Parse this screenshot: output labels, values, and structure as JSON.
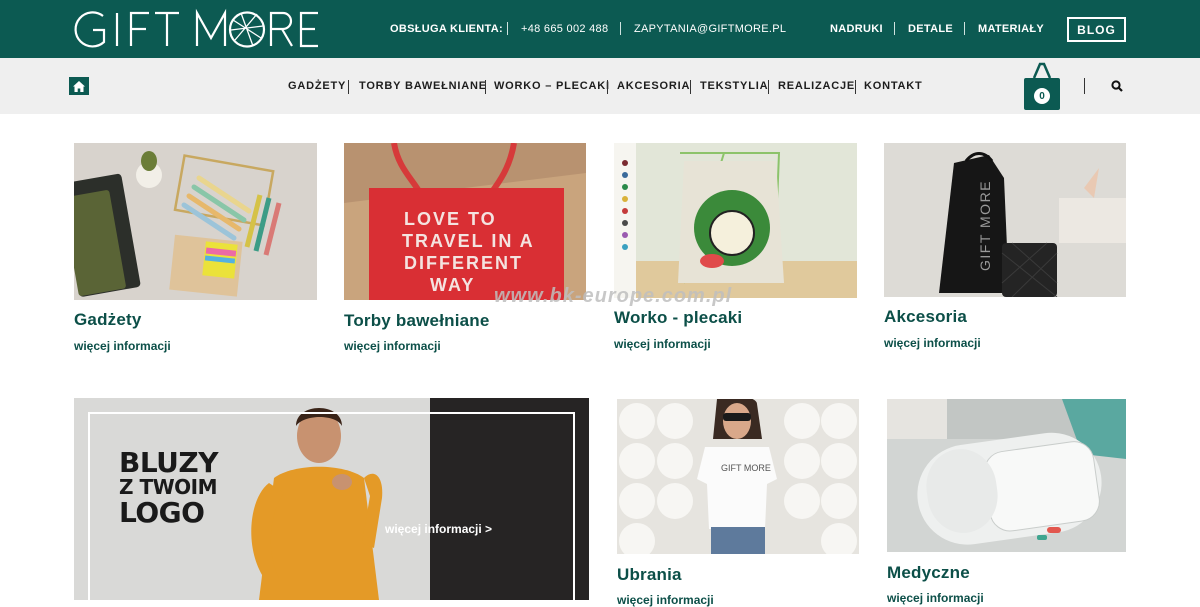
{
  "header": {
    "logo_text": "GIFT MORE",
    "customer_service_label": "OBSŁUGA KLIENTA:",
    "phone": "+48 665 002 488",
    "email": "ZAPYTANIA@GIFTMORE.PL",
    "links": [
      "NADRUKI",
      "DETALE",
      "MATERIAŁY"
    ],
    "blog_label": "BLOG"
  },
  "nav": {
    "items": [
      "GADŻETY",
      "TORBY BAWEŁNIANE",
      "WORKO – PLECAKI",
      "AKCESORIA",
      "TEKSTYLIA",
      "REALIZACJE",
      "KONTAKT"
    ],
    "cart_count": "0",
    "icons": [
      "home-icon",
      "cart-icon",
      "search-icon"
    ]
  },
  "tiles": [
    {
      "title": "Gadżety",
      "link": "więcej informacji"
    },
    {
      "title": "Torby bawełniane",
      "link": "więcej informacji",
      "image_text": [
        "LOVE TO",
        "TRAVEL IN A",
        "DIFFERENT",
        "WAY"
      ]
    },
    {
      "title": "Worko - plecaki",
      "link": "więcej informacji"
    },
    {
      "title": "Akcesoria",
      "link": "więcej informacji"
    },
    {
      "title": "Ubrania",
      "link": "więcej informacji"
    },
    {
      "title": "Medyczne",
      "link": "więcej informacji"
    }
  ],
  "banner": {
    "line1": "BLUZY",
    "line2": "Z TWOIM",
    "line3": "LOGO",
    "more": "więcej informacji >"
  },
  "watermark": "www.bk-europe.com.pl",
  "colors": {
    "brand": "#0c5a52",
    "nav_bg": "#efefef",
    "title": "#0c4f48"
  }
}
